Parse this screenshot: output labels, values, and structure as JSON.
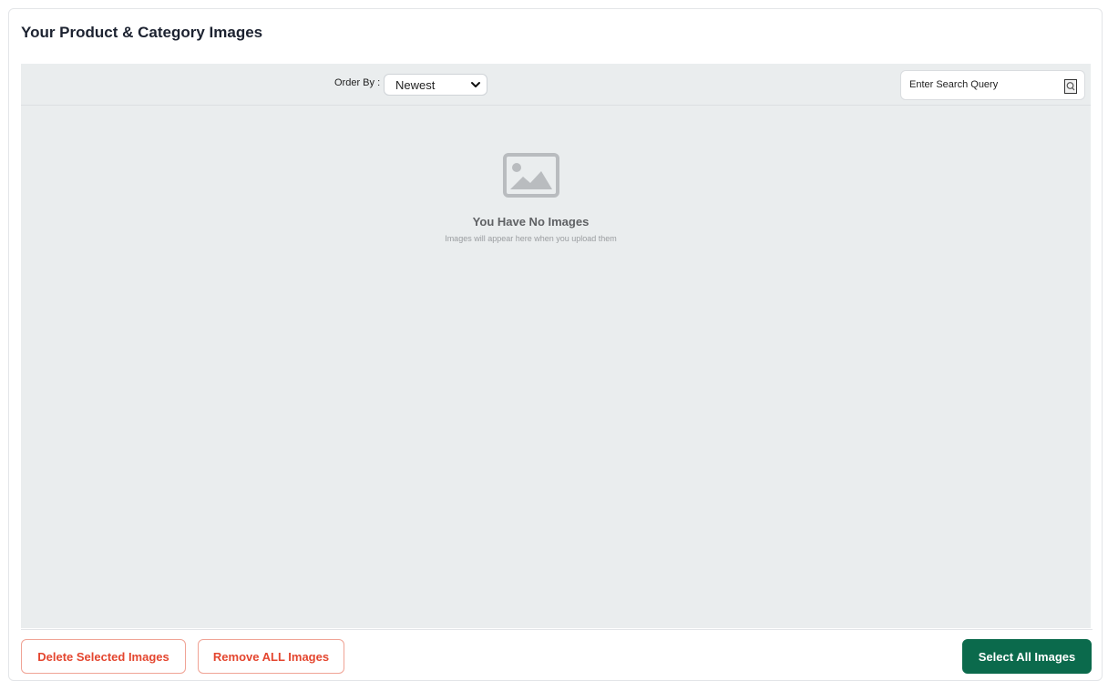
{
  "card": {
    "title": "Your Product & Category Images"
  },
  "toolbar": {
    "order_label": "Order By :",
    "order_selected": "Newest",
    "search_value": "Enter Search Query"
  },
  "empty_state": {
    "icon": "image-placeholder-icon",
    "title": "You Have No Images",
    "subtitle": "Images will appear here when you upload them"
  },
  "actions": {
    "delete_selected_label": "Delete Selected Images",
    "remove_all_label": "Remove ALL Images",
    "select_all_label": "Select All Images"
  },
  "colors": {
    "accent_green": "#0b6a4c",
    "danger_red": "#e4462f",
    "gallery_bg": "#eaedee"
  }
}
